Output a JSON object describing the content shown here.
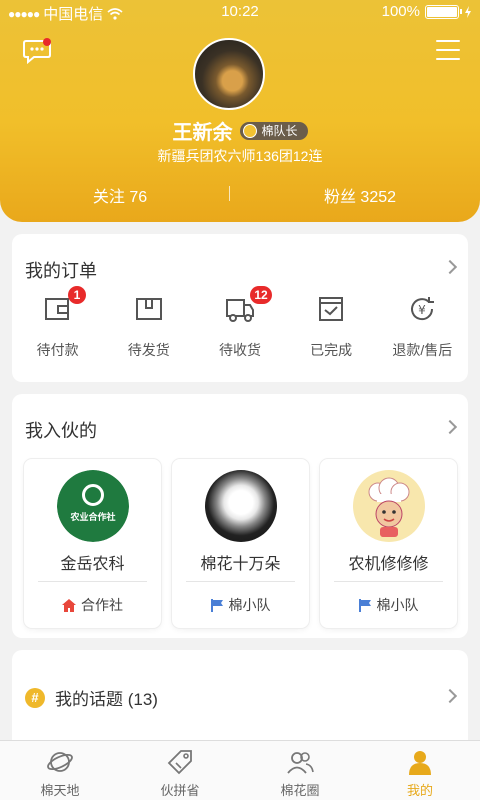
{
  "status_bar": {
    "carrier": "中国电信",
    "time": "10:22",
    "battery": "100%"
  },
  "profile": {
    "name": "王新余",
    "badge": "棉队长",
    "location": "新疆兵团农六师136团12连",
    "follow_label": "关注 76",
    "fans_label": "粉丝 3252"
  },
  "orders": {
    "title": "我的订单",
    "items": [
      {
        "label": "待付款",
        "count": "1",
        "icon": "wallet-icon"
      },
      {
        "label": "待发货",
        "count": "",
        "icon": "box-icon"
      },
      {
        "label": "待收货",
        "count": "12",
        "icon": "truck-icon"
      },
      {
        "label": "已完成",
        "count": "",
        "icon": "check-box-icon"
      },
      {
        "label": "退款/售后",
        "count": "",
        "icon": "refund-icon"
      }
    ]
  },
  "joined": {
    "title": "我入伙的",
    "items": [
      {
        "name": "金岳农科",
        "tag": "合作社",
        "tag_icon": "home-icon",
        "logo_text": "农业合作社"
      },
      {
        "name": "棉花十万朵",
        "tag": "棉小队",
        "tag_icon": "flag-icon"
      },
      {
        "name": "农机修修修",
        "tag": "棉小队",
        "tag_icon": "flag-icon"
      }
    ]
  },
  "topics": {
    "label": "我的话题 (13)"
  },
  "tabbar": {
    "items": [
      {
        "label": "棉天地",
        "icon": "planet-icon",
        "active": false
      },
      {
        "label": "伙拼省",
        "icon": "tag-icon",
        "active": false
      },
      {
        "label": "棉花圈",
        "icon": "people-icon",
        "active": false
      },
      {
        "label": "我的",
        "icon": "person-icon",
        "active": true
      }
    ]
  },
  "colors": {
    "brand": "#f1bf2a",
    "badge_red": "#e82a2a",
    "active_tab": "#e7a91b"
  }
}
